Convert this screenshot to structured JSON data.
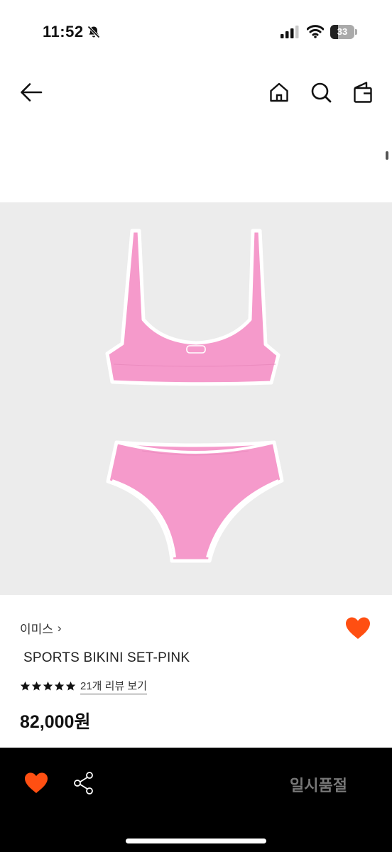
{
  "status": {
    "time": "11:52",
    "battery": "33",
    "battery_fraction": 0.33
  },
  "icons": {
    "bell": "bell-slash-icon",
    "signal": "cellular-signal-icon",
    "wifi": "wifi-icon",
    "back": "arrow-left-icon",
    "home": "home-icon",
    "search": "search-icon",
    "bag": "shopping-bag-icon",
    "wishlist": "heart-icon",
    "share": "share-icon",
    "star": "star-icon"
  },
  "product": {
    "brand": "이미스",
    "brand_chevron": "›",
    "name": "SPORTS BIKINI SET-PINK",
    "rating": 5,
    "review_link": "21개 리뷰 보기",
    "price": "82,000원",
    "wishlisted": true
  },
  "bottom_bar": {
    "status_label": "일시품절"
  },
  "colors": {
    "accent": "#ff4f12",
    "product_pink": "#f59acb",
    "image_background": "#ececec",
    "bottom_bar": "#000000",
    "soldout_text": "#777777"
  }
}
